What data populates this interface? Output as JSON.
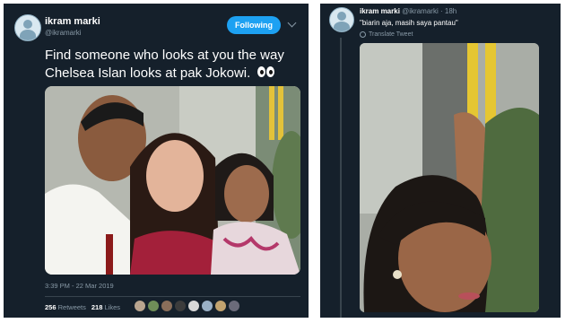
{
  "left_tweet": {
    "author_name": "ikram marki",
    "author_handle": "@ikramarki",
    "follow_label": "Following",
    "text": "Find someone who looks at you the way Chelsea Islan looks at pak Jokowi.",
    "timestamp": "3:39 PM - 22 Mar 2019",
    "retweets_count": "256",
    "retweets_label": "Retweets",
    "likes_count": "218",
    "likes_label": "Likes",
    "emoji": "eyes-icon"
  },
  "right_tweet": {
    "author_name": "ikram marki",
    "author_handle": "@ikramarki",
    "time_ago": "18h",
    "text": "\"biarin aja, masih saya pantau\"",
    "translate_label": "Translate Tweet"
  },
  "colors": {
    "background": "#15202b",
    "accent": "#1da1f2",
    "secondary_text": "#8899a6"
  }
}
